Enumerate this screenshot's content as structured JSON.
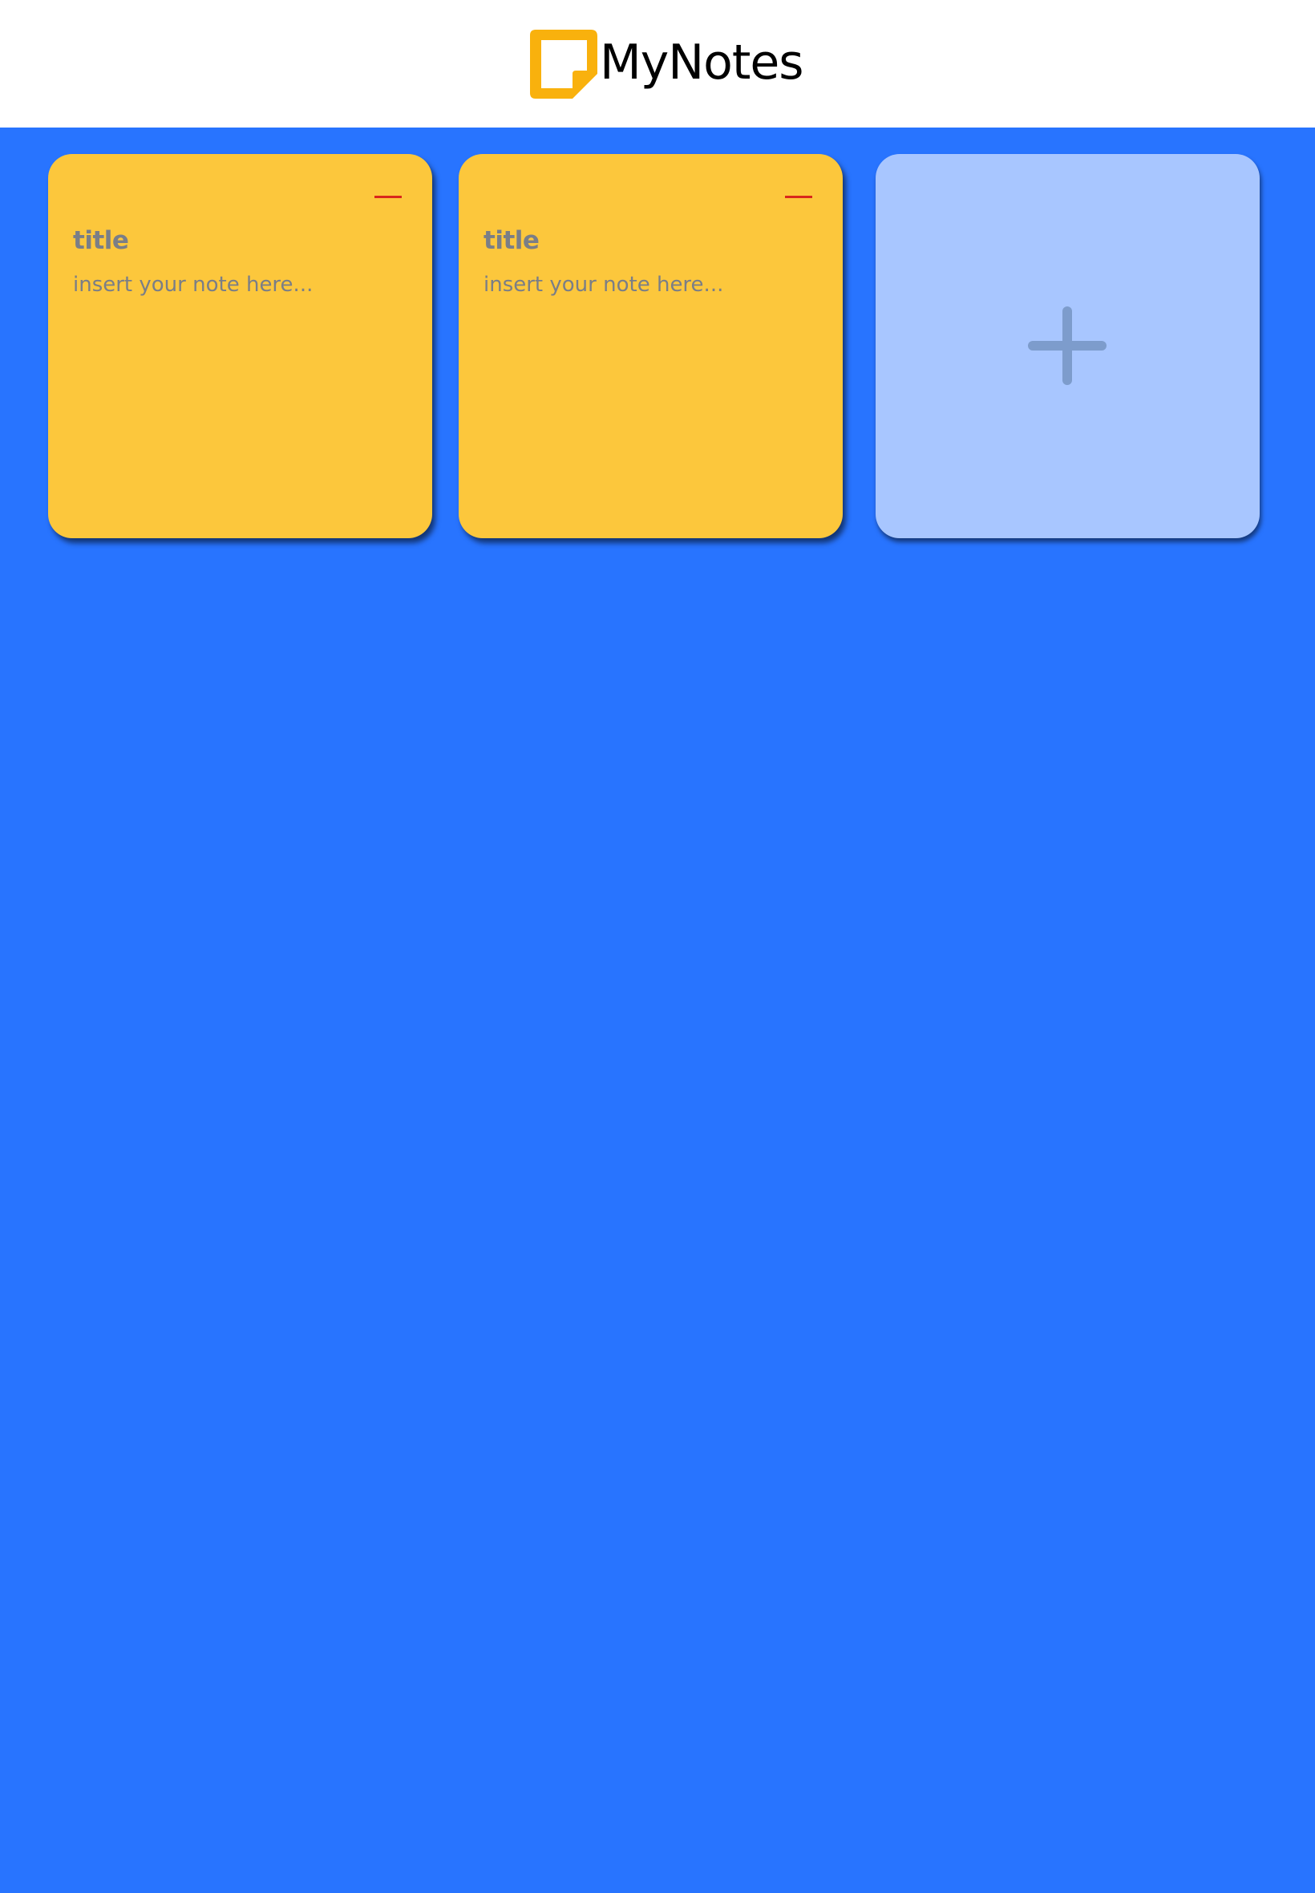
{
  "header": {
    "brand_name": "MyNotes",
    "logo_icon": "note-icon",
    "logo_color": "#f9b10d"
  },
  "notes": [
    {
      "title": "title",
      "placeholder": "insert your note here...",
      "remove_icon": "minus-icon"
    },
    {
      "title": "title",
      "placeholder": "insert your note here...",
      "remove_icon": "minus-icon"
    }
  ],
  "add_card": {
    "icon": "plus-icon"
  },
  "colors": {
    "background": "#2874ff",
    "note": "#fcc73c",
    "add_card": "#a8c6ff",
    "remove": "#d9261c",
    "text": "#7a7e87"
  }
}
